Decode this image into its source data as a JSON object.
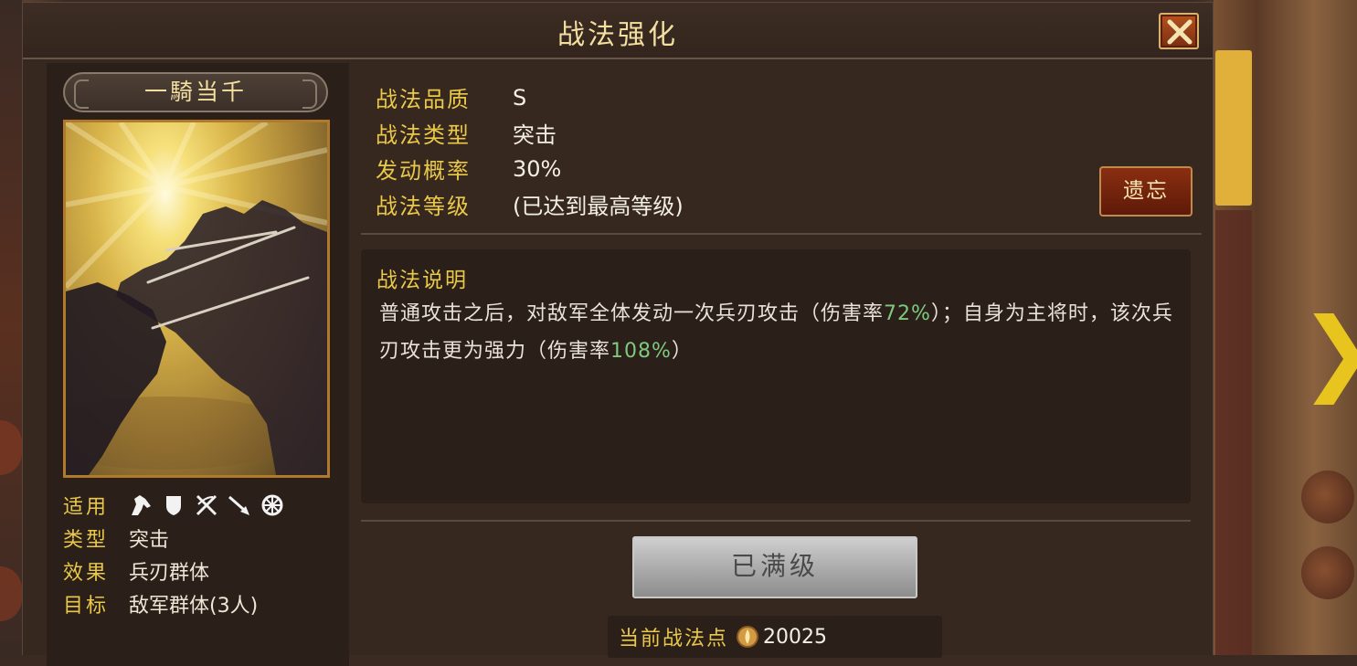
{
  "dialog": {
    "title": "战法强化"
  },
  "card": {
    "name": "一騎当千",
    "info": [
      {
        "key": "适用",
        "value": ""
      },
      {
        "key": "类型",
        "value": "突击"
      },
      {
        "key": "效果",
        "value": "兵刃群体"
      },
      {
        "key": "目标",
        "value": "敌军群体(3人)"
      }
    ],
    "unit_icons": [
      "cavalry-icon",
      "shield-icon",
      "bow-icon",
      "spear-icon",
      "wheel-icon"
    ]
  },
  "stats": [
    {
      "key": "战法品质",
      "value": "S"
    },
    {
      "key": "战法类型",
      "value": "突击"
    },
    {
      "key": "发动概率",
      "value": "30%"
    },
    {
      "key": "战法等级",
      "value": "(已达到最高等级)"
    }
  ],
  "forget_button": "遗忘",
  "description": {
    "title": "战法说明",
    "seg1": "普通攻击之后，对敌军全体发动一次兵刃攻击（伤害率",
    "hl1": "72%",
    "seg2": "）；自身为主将时，该次兵刃攻击更为强力（伤害率",
    "hl2": "108%",
    "seg3": "）"
  },
  "max_button": "已满级",
  "points": {
    "label": "当前战法点",
    "value": "20025"
  },
  "colors": {
    "accent_gold": "#e9c84a",
    "highlight_green": "#7fc97f",
    "title_text": "#f3dfa0"
  }
}
